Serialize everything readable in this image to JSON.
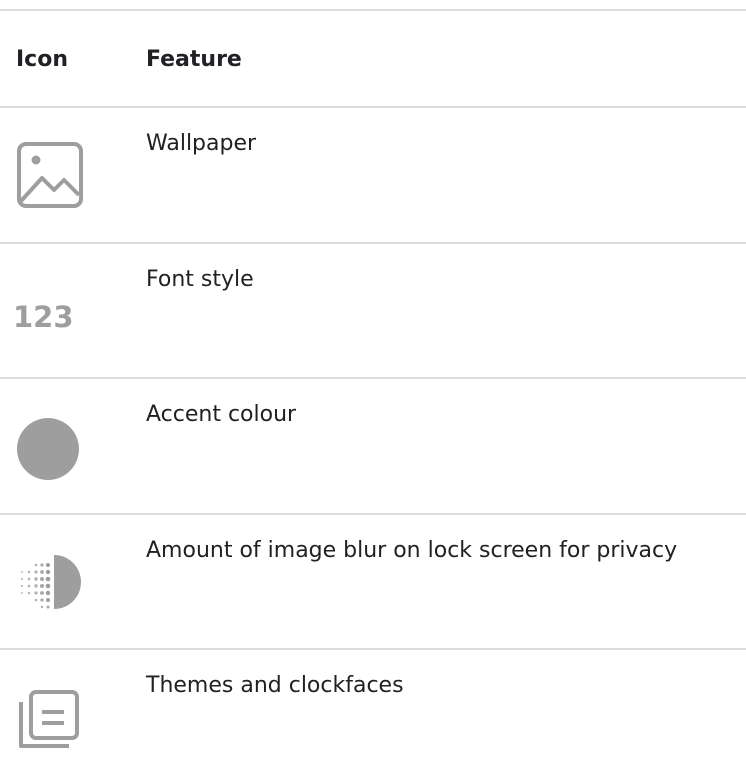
{
  "table": {
    "headers": {
      "icon": "Icon",
      "feature": "Feature"
    },
    "rows": [
      {
        "icon": "wallpaper-icon",
        "feature": "Wallpaper"
      },
      {
        "icon": "font-style-icon",
        "icon_text": "123",
        "feature": "Font style"
      },
      {
        "icon": "accent-colour-icon",
        "feature": "Accent colour"
      },
      {
        "icon": "lock-screen-blur-icon",
        "feature": "Amount of image blur on lock screen for privacy"
      },
      {
        "icon": "themes-clockfaces-icon",
        "feature": "Themes and clockfaces"
      }
    ]
  },
  "colors": {
    "divider": "#dadce0",
    "icon_gray": "#9e9e9e",
    "text": "#202124"
  }
}
